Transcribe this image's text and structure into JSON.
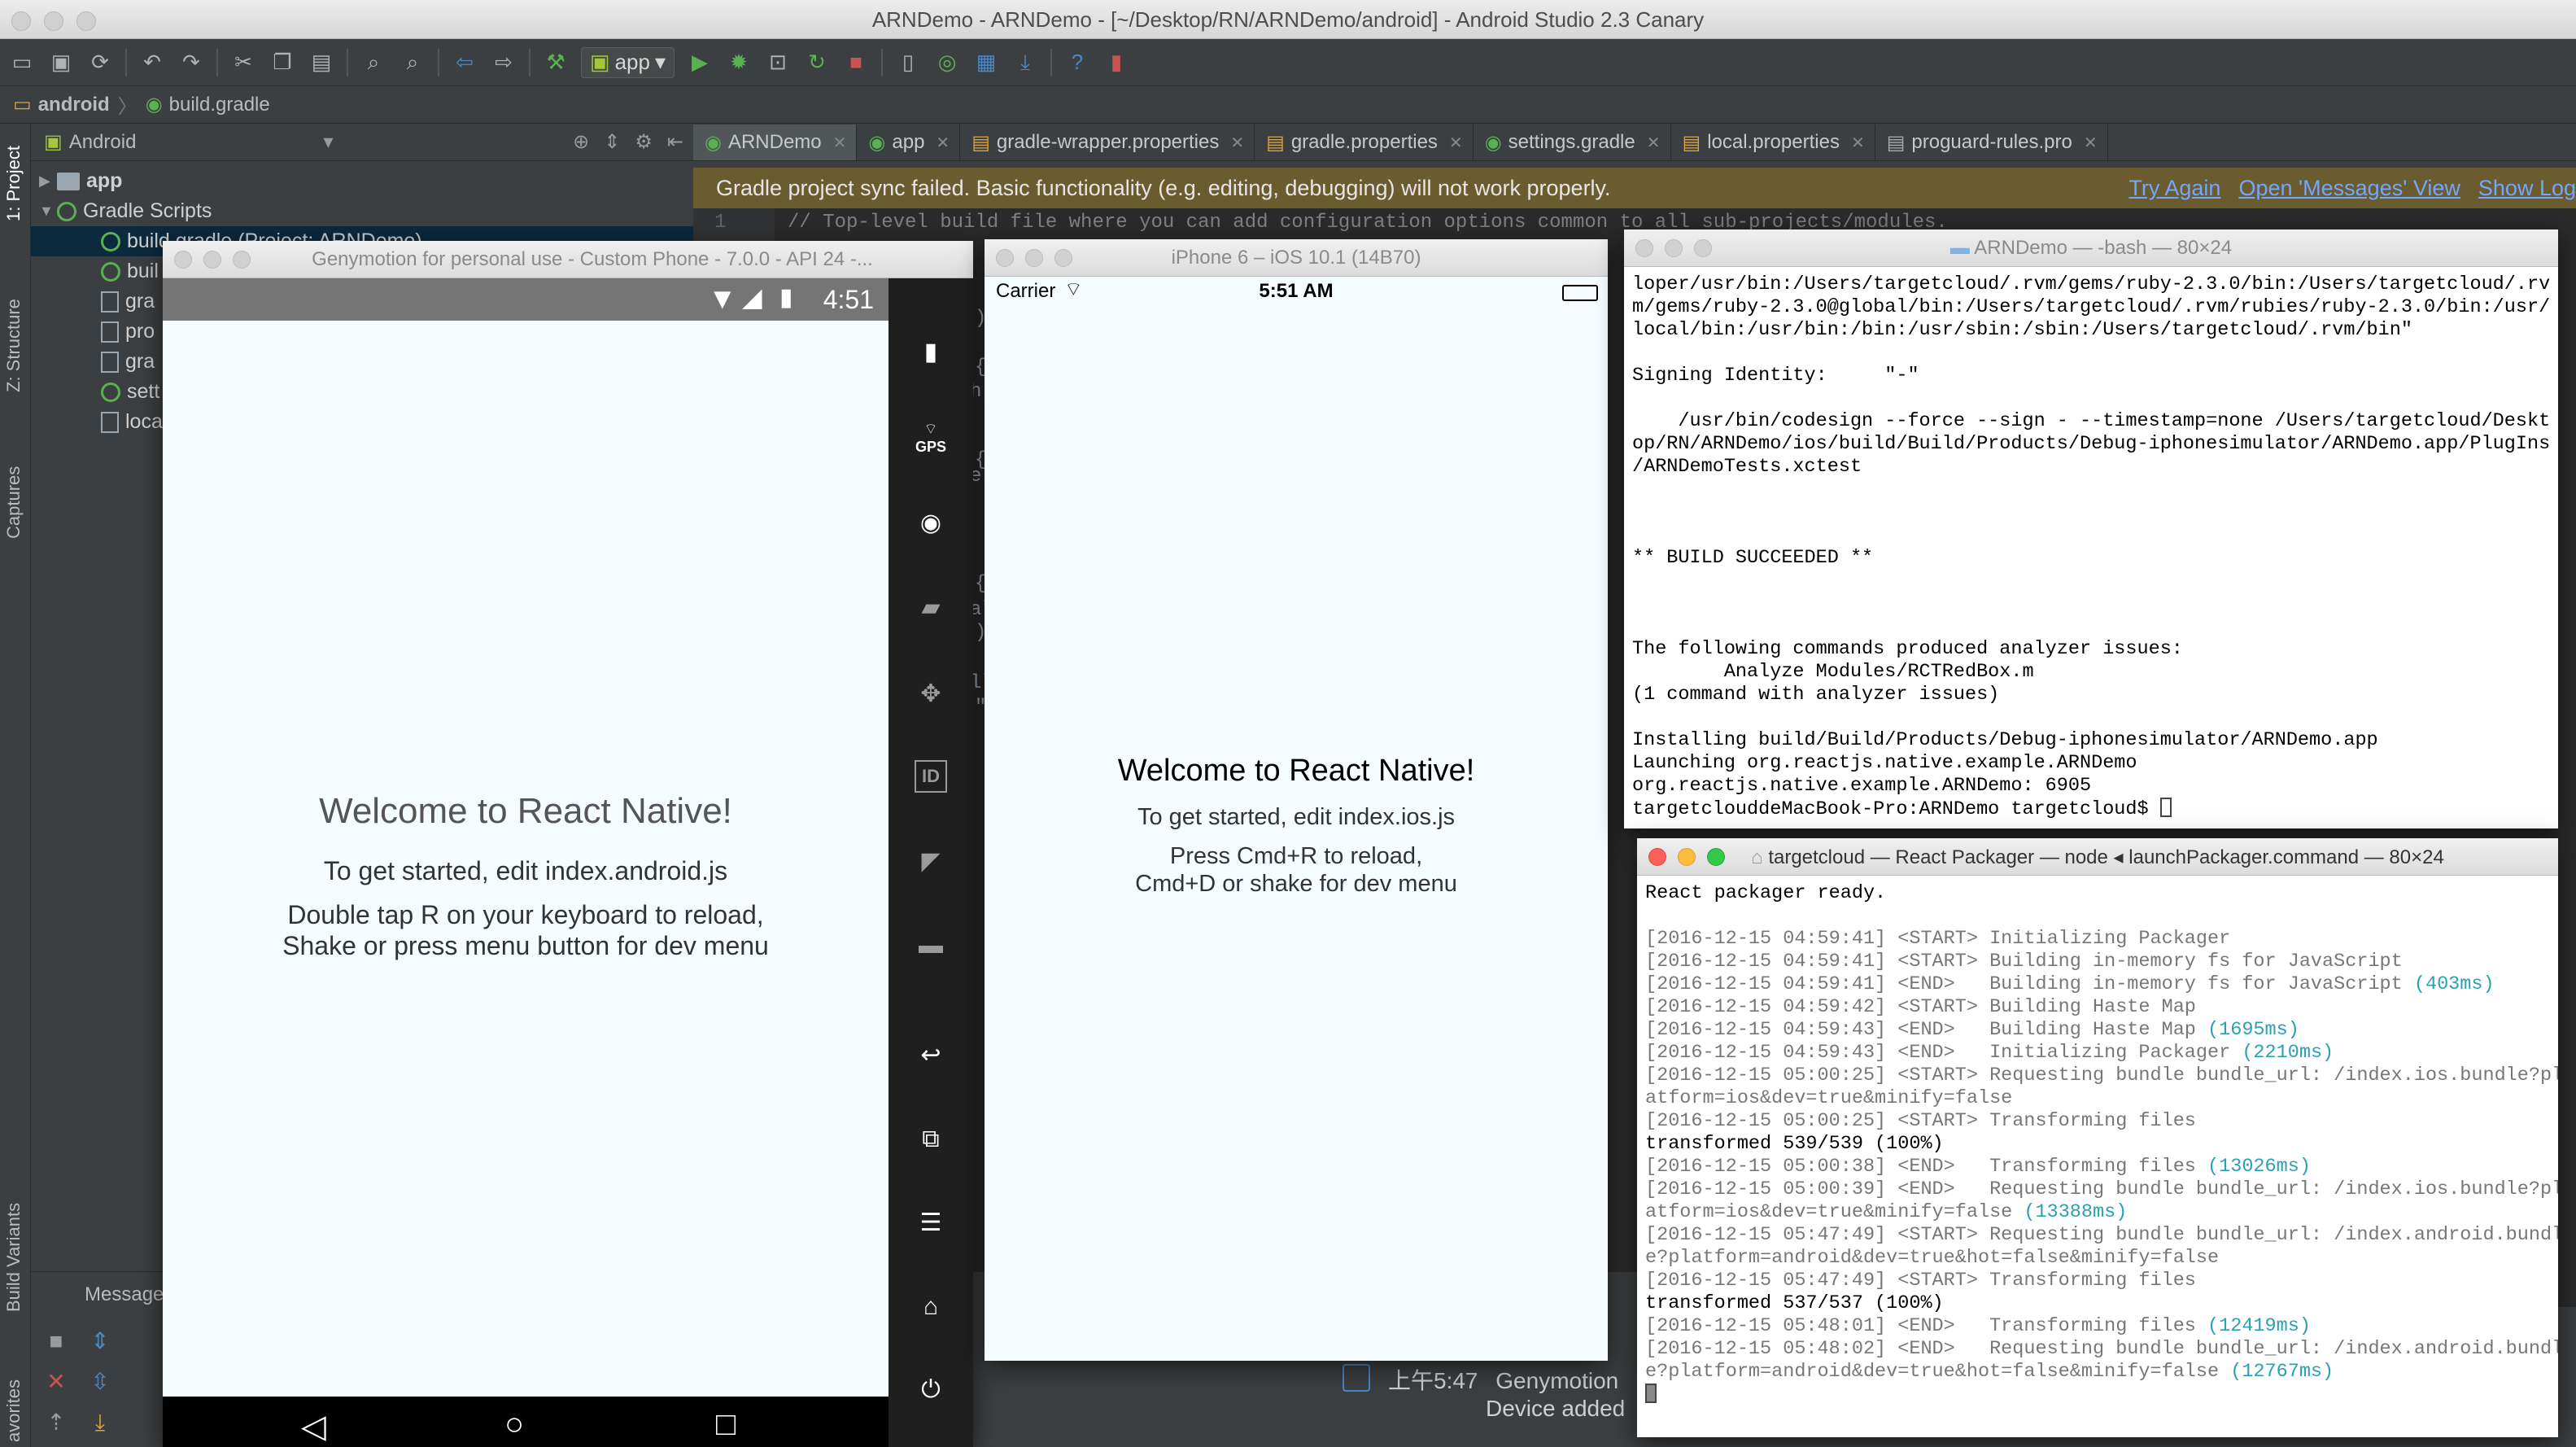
{
  "mac_title": "ARNDemo - ARNDemo - [~/Desktop/RN/ARNDemo/android] - Android Studio 2.3 Canary",
  "toolbar": {
    "run_config": "app"
  },
  "breadcrumb": [
    "android",
    "build.gradle"
  ],
  "left_tool_tabs": [
    "1: Project",
    "Z: Structure",
    "Captures",
    "Build Variants",
    "avorites"
  ],
  "project_panel": {
    "view_mode": "Android",
    "tree": [
      {
        "label": "app",
        "kind": "folder",
        "expanded": false
      },
      {
        "label": "Gradle Scripts",
        "kind": "gradle",
        "expanded": true
      },
      {
        "label": "build.gradle (Project: ARNDemo)",
        "kind": "gradle",
        "selected": true
      },
      {
        "label": "buil",
        "kind": "gradle"
      },
      {
        "label": "gra",
        "kind": "file"
      },
      {
        "label": "pro",
        "kind": "file"
      },
      {
        "label": "gra",
        "kind": "file"
      },
      {
        "label": "sett",
        "kind": "gradle"
      },
      {
        "label": "loca",
        "kind": "file"
      }
    ]
  },
  "editor_tabs": [
    {
      "label": "ARNDemo",
      "active": true
    },
    {
      "label": "app",
      "active": false
    },
    {
      "label": "gradle-wrapper.properties",
      "active": false
    },
    {
      "label": "gradle.properties",
      "active": false
    },
    {
      "label": "settings.gradle",
      "active": false
    },
    {
      "label": "local.properties",
      "active": false
    },
    {
      "label": "proguard-rules.pro",
      "active": false
    }
  ],
  "sync_banner": {
    "message": "Gradle project sync failed. Basic functionality (e.g. editing, debugging) will not work properly.",
    "links": [
      "Try Again",
      "Open 'Messages' View",
      "Show Log"
    ]
  },
  "editor": {
    "line_number": "1",
    "line_1": "// Top-level build file where you can add configuration options common to all sub-projects/modules."
  },
  "messages_panel": {
    "label": "Messages:"
  },
  "event_log": {
    "time": "上午5:47",
    "title": "Genymotion",
    "subtitle": "Device added"
  },
  "genymotion": {
    "title": "Genymotion for personal use - Custom Phone - 7.0.0 - API 24 -...",
    "clock": "4:51",
    "welcome": "Welcome to React Native!",
    "instructions": "To get started, edit index.android.js",
    "reload_1": "Double tap R on your keyboard to reload,",
    "reload_2": "Shake or press menu button for dev menu",
    "gps_label": "GPS",
    "id_label": "ID"
  },
  "ios_sim": {
    "title": "iPhone 6 – iOS 10.1 (14B70)",
    "carrier": "Carrier",
    "time": "5:51 AM",
    "welcome": "Welcome to React Native!",
    "instructions": "To get started, edit index.ios.js",
    "reload_1": "Press Cmd+R to reload,",
    "reload_2": "Cmd+D or shake for dev menu"
  },
  "terminal_bash": {
    "title": "ARNDemo — -bash — 80×24",
    "lines": [
      "loper/usr/bin:/Users/targetcloud/.rvm/gems/ruby-2.3.0/bin:/Users/targetcloud/.rv",
      "m/gems/ruby-2.3.0@global/bin:/Users/targetcloud/.rvm/rubies/ruby-2.3.0/bin:/usr/",
      "local/bin:/usr/bin:/bin:/usr/sbin:/sbin:/Users/targetcloud/.rvm/bin\"",
      "",
      "Signing Identity:     \"-\"",
      "",
      "    /usr/bin/codesign --force --sign - --timestamp=none /Users/targetcloud/Deskt",
      "op/RN/ARNDemo/ios/build/Build/Products/Debug-iphonesimulator/ARNDemo.app/PlugIns",
      "/ARNDemoTests.xctest",
      "",
      "",
      "",
      "** BUILD SUCCEEDED **",
      "",
      "",
      "",
      "The following commands produced analyzer issues:",
      "        Analyze Modules/RCTRedBox.m",
      "(1 command with analyzer issues)",
      "",
      "Installing build/Build/Products/Debug-iphonesimulator/ARNDemo.app",
      "Launching org.reactjs.native.example.ARNDemo",
      "org.reactjs.native.example.ARNDemo: 6905"
    ],
    "prompt": "targetclouddeMacBook-Pro:ARNDemo targetcloud$ "
  },
  "terminal_packager": {
    "title": "targetcloud — React Packager — node ◂ launchPackager.command — 80×24",
    "ready": "React packager ready.",
    "log": [
      {
        "pre": "[2016-12-15 04:59:41] <START> Initializing Packager",
        "ms": ""
      },
      {
        "pre": "[2016-12-15 04:59:41] <START> Building in-memory fs for JavaScript",
        "ms": ""
      },
      {
        "pre": "[2016-12-15 04:59:41] <END>   Building in-memory fs for JavaScript ",
        "ms": "(403ms)"
      },
      {
        "pre": "[2016-12-15 04:59:42] <START> Building Haste Map",
        "ms": ""
      },
      {
        "pre": "[2016-12-15 04:59:43] <END>   Building Haste Map ",
        "ms": "(1695ms)"
      },
      {
        "pre": "[2016-12-15 04:59:43] <END>   Initializing Packager ",
        "ms": "(2210ms)"
      },
      {
        "pre": "[2016-12-15 05:00:25] <START> Requesting bundle bundle_url: /index.ios.bundle?pl",
        "ms": ""
      },
      {
        "pre": "atform=ios&dev=true&minify=false",
        "ms": ""
      },
      {
        "pre": "[2016-12-15 05:00:25] <START> Transforming files",
        "ms": ""
      },
      {
        "plain": "transformed 539/539 (100%)"
      },
      {
        "pre": "[2016-12-15 05:00:38] <END>   Transforming files ",
        "ms": "(13026ms)"
      },
      {
        "pre": "[2016-12-15 05:00:39] <END>   Requesting bundle bundle_url: /index.ios.bundle?pl",
        "ms": ""
      },
      {
        "pre": "atform=ios&dev=true&minify=false ",
        "ms": "(13388ms)"
      },
      {
        "pre": "[2016-12-15 05:47:49] <START> Requesting bundle bundle_url: /index.android.bundl",
        "ms": ""
      },
      {
        "pre": "e?platform=android&dev=true&hot=false&minify=false",
        "ms": ""
      },
      {
        "pre": "[2016-12-15 05:47:49] <START> Transforming files",
        "ms": ""
      },
      {
        "plain": "transformed 537/537 (100%)"
      },
      {
        "pre": "[2016-12-15 05:48:01] <END>   Transforming files ",
        "ms": "(12419ms)"
      },
      {
        "pre": "[2016-12-15 05:48:02] <END>   Requesting bundle bundle_url: /index.android.bundl",
        "ms": ""
      },
      {
        "pre": "e?platform=android&dev=true&hot=false&minify=false ",
        "ms": "(12767ms)"
      }
    ]
  },
  "colors": {
    "ide_bg": "#3c3f41",
    "editor_bg": "#2b2b2b",
    "banner_bg": "#6b5c2f",
    "link": "#74a6ff",
    "react_bg": "#f5fcff",
    "log_ms": "#2aa1b3"
  }
}
